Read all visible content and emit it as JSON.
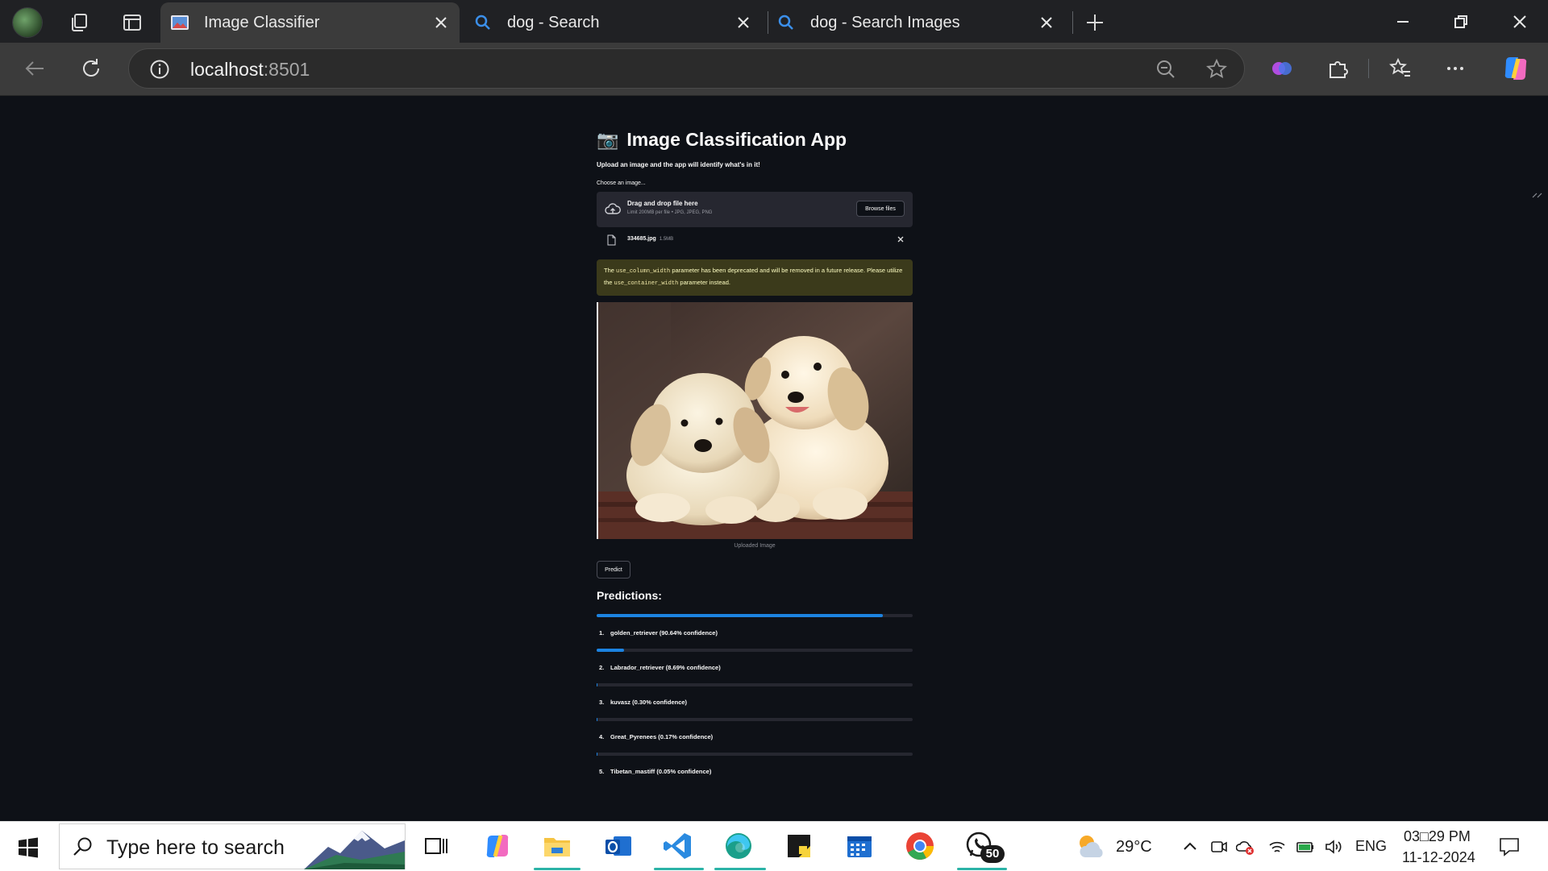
{
  "browser": {
    "tabs": [
      {
        "title": "Image Classifier",
        "active": true
      },
      {
        "title": "dog - Search",
        "active": false
      },
      {
        "title": "dog - Search Images",
        "active": false
      }
    ],
    "url_host": "localhost",
    "url_port": ":8501"
  },
  "app": {
    "title_icon": "📷",
    "title": "Image Classification App",
    "subtitle": "Upload an image and the app will identify what's in it!",
    "uploader_label": "Choose an image...",
    "dropzone_title": "Drag and drop file here",
    "dropzone_limit": "Limit 200MB per file • JPG, JPEG, PNG",
    "browse_label": "Browse files",
    "file_name": "334685.jpg",
    "file_size": "1.5MB",
    "warning": {
      "t1": "The ",
      "code1": "use_column_width",
      "t2": " parameter has been deprecated and will be removed in a future release. Please utilize the ",
      "code2": "use_container_width",
      "t3": " parameter instead."
    },
    "image_caption": "Uploaded Image",
    "predict_label": "Predict",
    "predictions_heading": "Predictions:",
    "predictions": [
      {
        "rank": "1.",
        "text": "golden_retriever (90.64% confidence)",
        "confidence": 0.9064
      },
      {
        "rank": "2.",
        "text": "Labrador_retriever (8.69% confidence)",
        "confidence": 0.0869
      },
      {
        "rank": "3.",
        "text": "kuvasz (0.30% confidence)",
        "confidence": 0.003
      },
      {
        "rank": "4.",
        "text": "Great_Pyrenees (0.17% confidence)",
        "confidence": 0.0017
      },
      {
        "rank": "5.",
        "text": "Tibetan_mastiff (0.05% confidence)",
        "confidence": 0.0005
      }
    ]
  },
  "taskbar": {
    "search_placeholder": "Type here to search",
    "weather_temp": "29°C",
    "language": "ENG",
    "time": "03□29 PM",
    "date": "11-12-2024",
    "whatsapp_badge": "50"
  },
  "colors": {
    "page_bg": "#0e1117",
    "progress_fill": "#1c83e1",
    "warning_bg": "#3b3a1b",
    "warning_text": "#ffffc2"
  }
}
